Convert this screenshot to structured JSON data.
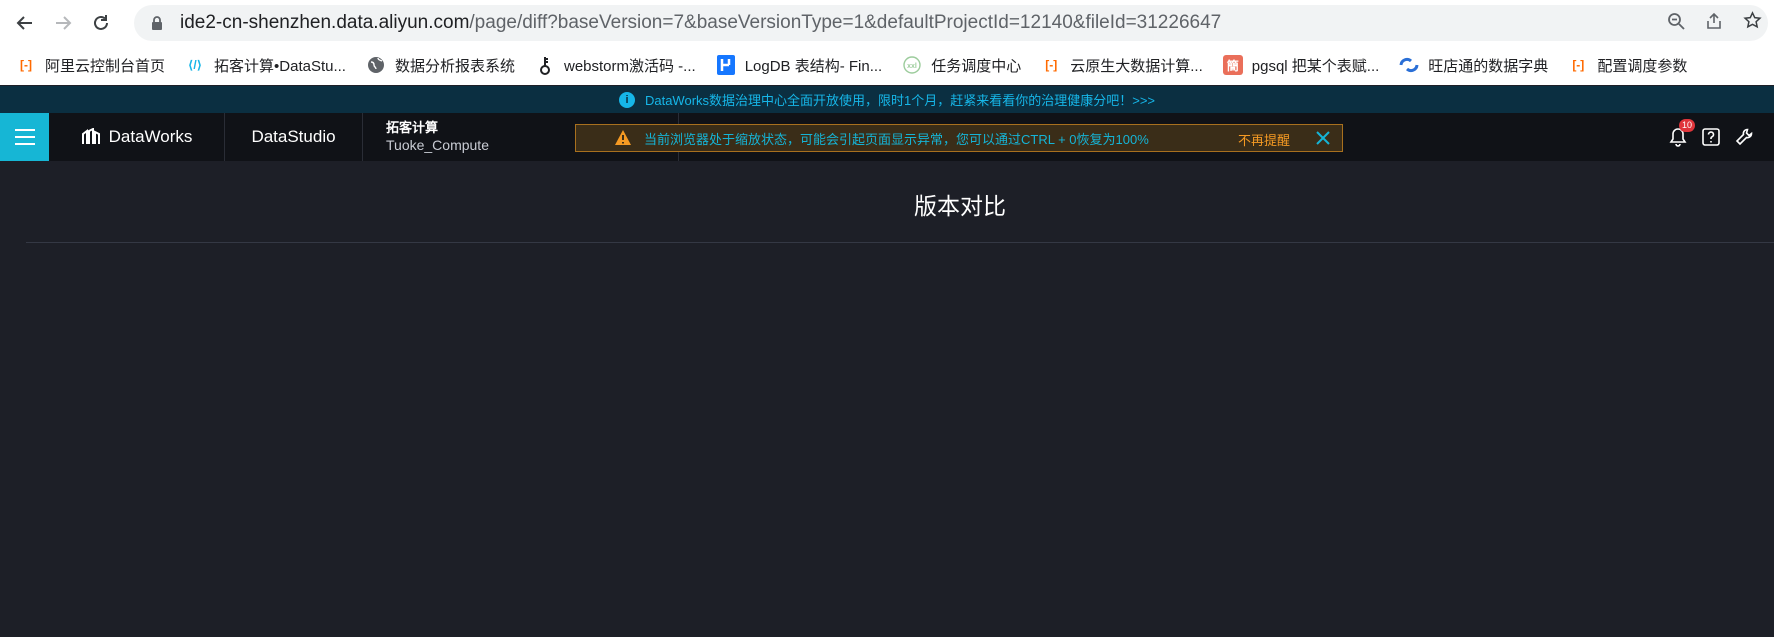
{
  "browser": {
    "url_host": "ide2-cn-shenzhen.data.aliyun.com",
    "url_path": "/page/diff?baseVersion=7&baseVersionType=1&defaultProjectId=12140&fileId=31226647"
  },
  "bookmarks": [
    {
      "label": "阿里云控制台首页",
      "icon": "aliyun-icon",
      "color": "#ff6a00",
      "glyph": "[-]"
    },
    {
      "label": "拓客计算•DataStu...",
      "icon": "datastudio-icon",
      "color": "#16b6e8",
      "glyph": "⟨/⟩"
    },
    {
      "label": "数据分析报表系统",
      "icon": "globe-icon",
      "color": "#5f6368",
      "glyph": "◍"
    },
    {
      "label": "webstorm激活码 -...",
      "icon": "key-icon",
      "color": "#202124",
      "glyph": "⚷"
    },
    {
      "label": "LogDB 表结构- Fin...",
      "icon": "logdb-icon",
      "color": "#1677ff",
      "glyph": "▚"
    },
    {
      "label": "任务调度中心",
      "icon": "schedule-icon",
      "color": "#9ccc9c",
      "glyph": "◌"
    },
    {
      "label": "云原生大数据计算...",
      "icon": "aliyun-icon",
      "color": "#ff6a00",
      "glyph": "[-]"
    },
    {
      "label": "pgsql 把某个表赋...",
      "icon": "jianshu-icon",
      "color": "#ea6f5a",
      "glyph": "簡"
    },
    {
      "label": "旺店通的数据字典",
      "icon": "wdt-icon",
      "color": "#2a6fd6",
      "glyph": "◐"
    },
    {
      "label": "配置调度参数",
      "icon": "aliyun-icon",
      "color": "#ff6a00",
      "glyph": "[-]"
    }
  ],
  "announcement": {
    "text": "DataWorks数据治理中心全面开放使用，限时1个月，赶紧来看看你的治理健康分吧！>>>"
  },
  "appbar": {
    "brand": "DataWorks",
    "module": "DataStudio",
    "project_name": "拓客计算",
    "project_id": "Tuoke_Compute",
    "notification_count": "10"
  },
  "warning": {
    "text": "当前浏览器处于缩放状态，可能会引起页面显示异常，您可以通过CTRL + 0恢复为100%",
    "dismiss": "不再提醒"
  },
  "page": {
    "title": "版本对比"
  },
  "colors": {
    "accent": "#16b6d5",
    "warning": "#f59a23",
    "background": "#1d1f27"
  }
}
